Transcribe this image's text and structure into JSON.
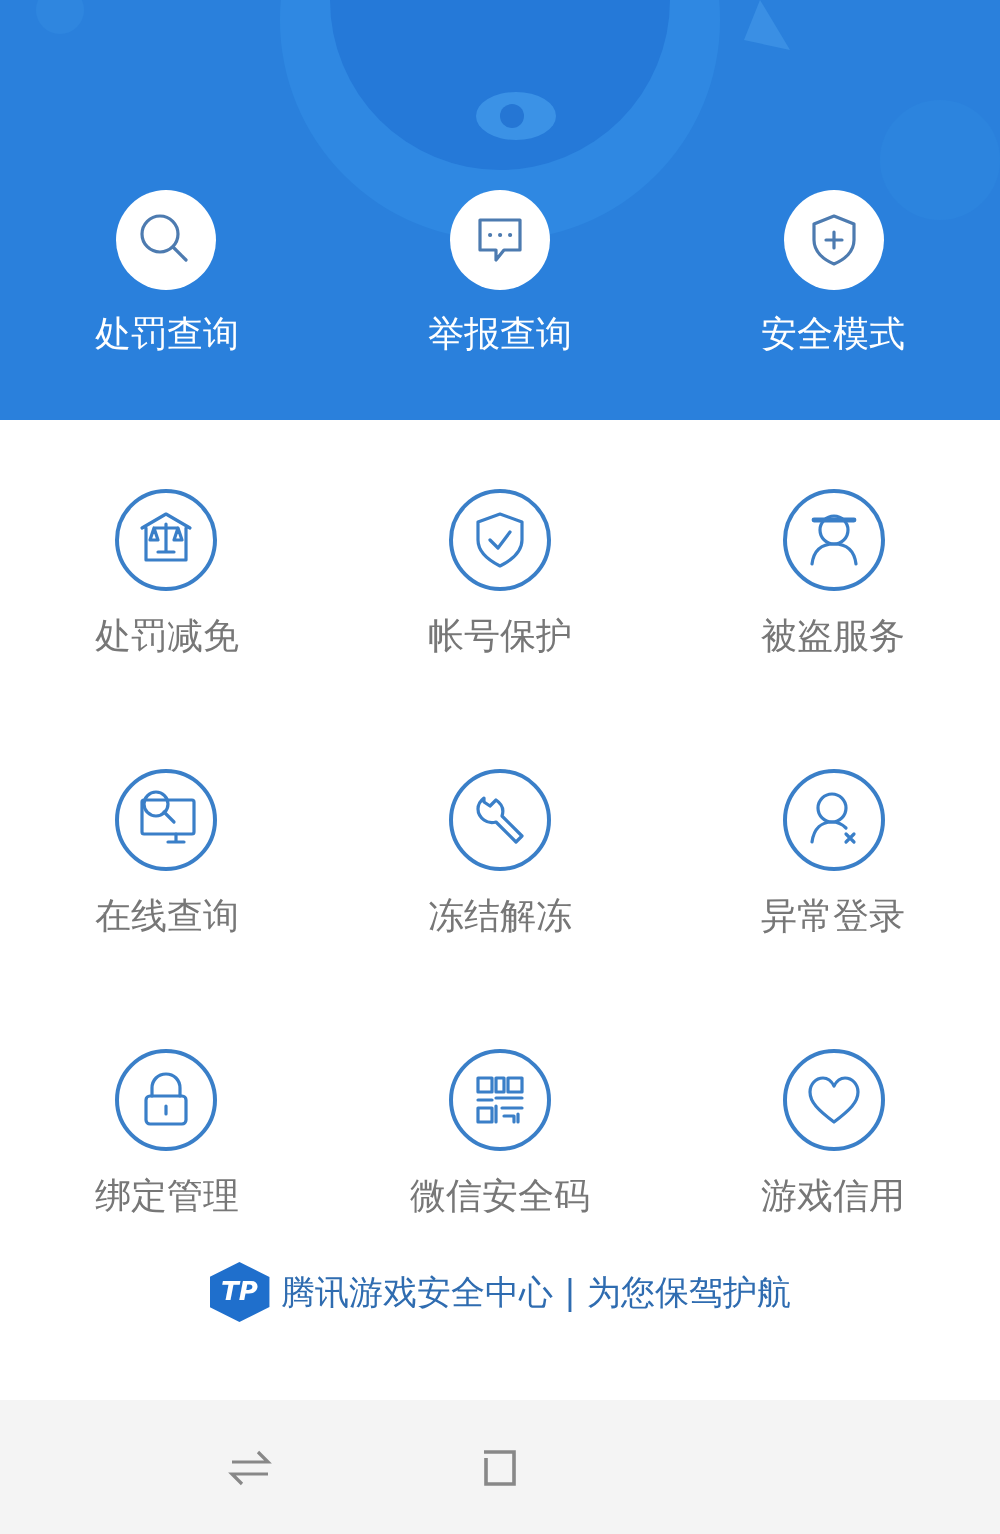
{
  "header": {
    "kind": "picture",
    "actions": [
      {
        "label": "处罚查询",
        "kind": "search"
      },
      {
        "label": "举报查询",
        "kind": "message"
      },
      {
        "label": "安全模式",
        "kind": "shield-plus"
      }
    ]
  },
  "services": [
    {
      "label": "处罚减免",
      "kind": "scales"
    },
    {
      "label": "帐号保护",
      "kind": "shield-check"
    },
    {
      "label": "被盗服务",
      "kind": "masked-person"
    },
    {
      "label": "在线查询",
      "kind": "screen-search"
    },
    {
      "label": "冻结解冻",
      "kind": "wrench"
    },
    {
      "label": "异常登录",
      "kind": "person-x"
    },
    {
      "label": "绑定管理",
      "kind": "lock"
    },
    {
      "label": "微信安全码",
      "kind": "qr-code"
    },
    {
      "label": "游戏信用",
      "kind": "heart"
    }
  ],
  "footer": {
    "logo": "TP",
    "slogan": "腾讯游戏安全中心 | 为您保驾护航"
  }
}
